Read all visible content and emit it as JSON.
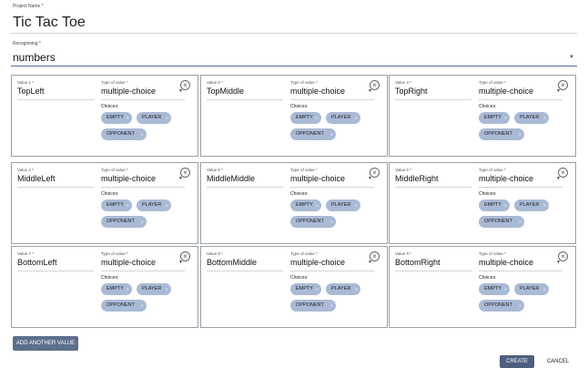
{
  "project_name": {
    "label": "Project Name *",
    "value": "Tic Tac Toe"
  },
  "recognising": {
    "label": "Recognising *",
    "value": "numbers"
  },
  "type_label_text": "Type of value *",
  "choices_label_text": "Choices:",
  "values": [
    {
      "label": "Value 1 *",
      "name": "TopLeft",
      "type": "multiple-choice",
      "choices": [
        "EMPTY",
        "PLAYER",
        "OPPONENT"
      ]
    },
    {
      "label": "Value 2 *",
      "name": "TopMiddle",
      "type": "multiple-choice",
      "choices": [
        "EMPTY",
        "PLAYER",
        "OPPONENT"
      ]
    },
    {
      "label": "Value 3 *",
      "name": "TopRight",
      "type": "multiple-choice",
      "choices": [
        "EMPTY",
        "PLAYER",
        "OPPONENT"
      ]
    },
    {
      "label": "Value 4 *",
      "name": "MiddleLeft",
      "type": "multiple-choice",
      "choices": [
        "EMPTY",
        "PLAYER",
        "OPPONENT"
      ]
    },
    {
      "label": "Value 5 *",
      "name": "MiddleMiddle",
      "type": "multiple-choice",
      "choices": [
        "EMPTY",
        "PLAYER",
        "OPPONENT"
      ]
    },
    {
      "label": "Value 6 *",
      "name": "MiddleRight",
      "type": "multiple-choice",
      "choices": [
        "EMPTY",
        "PLAYER",
        "OPPONENT"
      ]
    },
    {
      "label": "Value 7 *",
      "name": "BottomLeft",
      "type": "multiple-choice",
      "choices": [
        "EMPTY",
        "PLAYER",
        "OPPONENT"
      ]
    },
    {
      "label": "Value 8 *",
      "name": "BottomMiddle",
      "type": "multiple-choice",
      "choices": [
        "EMPTY",
        "PLAYER",
        "OPPONENT"
      ]
    },
    {
      "label": "Value 9 *",
      "name": "BottomRight",
      "type": "multiple-choice",
      "choices": [
        "EMPTY",
        "PLAYER",
        "OPPONENT"
      ]
    }
  ],
  "buttons": {
    "add_value": "ADD ANOTHER VALUE",
    "create": "CREATE",
    "cancel": "CANCEL"
  },
  "colors": {
    "chip": "#a9bad6",
    "primary_button": "#4d5f7f",
    "add_button": "#5c6f8c"
  }
}
